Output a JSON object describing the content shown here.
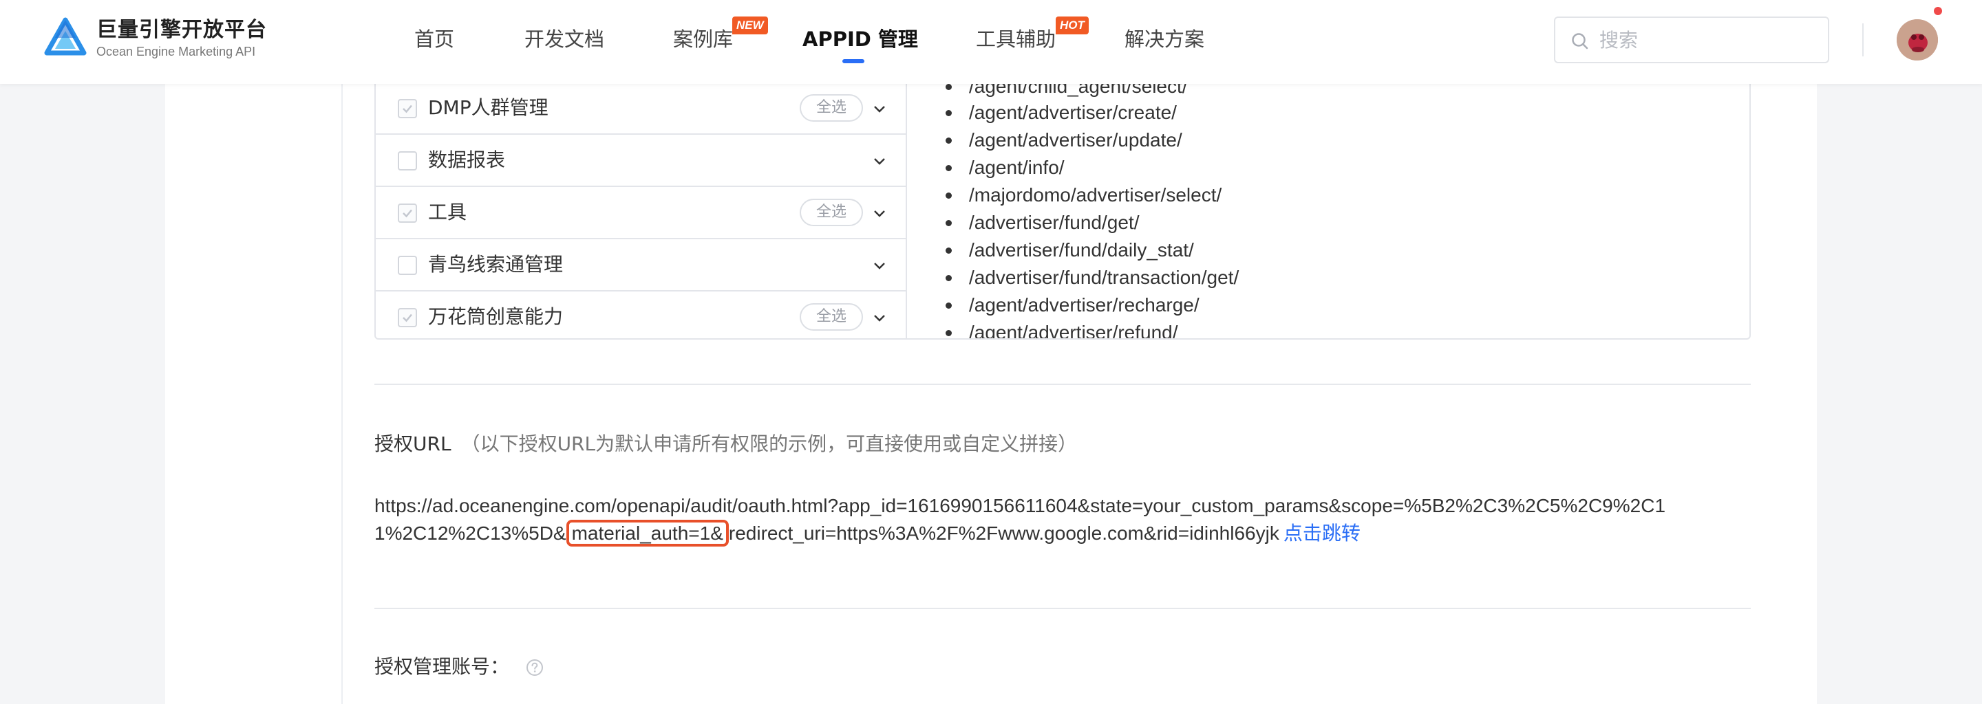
{
  "header": {
    "logo_title": "巨量引擎开放平台",
    "logo_subtitle": "Ocean Engine Marketing API",
    "nav": [
      {
        "label": "首页"
      },
      {
        "label": "开发文档"
      },
      {
        "label": "案例库",
        "badge": "NEW"
      },
      {
        "label": "APPID 管理",
        "active": true
      },
      {
        "label": "工具辅助",
        "badge": "HOT"
      },
      {
        "label": "解决方案"
      }
    ],
    "search_placeholder": "搜索",
    "accent_color": "#2a6ef6",
    "badge_color": "#f15a24"
  },
  "permissions": {
    "rows": [
      {
        "label": "DMP人群管理",
        "checked": true,
        "select_all": "全选"
      },
      {
        "label": "数据报表",
        "checked": false
      },
      {
        "label": "工具",
        "checked": true,
        "select_all": "全选"
      },
      {
        "label": "青鸟线索通管理",
        "checked": false
      },
      {
        "label": "万花筒创意能力",
        "checked": true,
        "select_all": "全选"
      }
    ],
    "apis": [
      "/agent/child_agent/select/",
      "/agent/advertiser/create/",
      "/agent/advertiser/update/",
      "/agent/info/",
      "/majordomo/advertiser/select/",
      "/advertiser/fund/get/",
      "/advertiser/fund/daily_stat/",
      "/advertiser/fund/transaction/get/",
      "/agent/advertiser/recharge/",
      "/agent/advertiser/refund/"
    ]
  },
  "auth_url": {
    "title": "授权URL",
    "note": "（以下授权URL为默认申请所有权限的示例，可直接使用或自定义拼接）",
    "line1": "https://ad.oceanengine.com/openapi/audit/oauth.html?app_id=1616990156611604&state=your_custom_params&scope=%5B2%2C3%2C5%2C9%2C1",
    "line2_before": "1%2C12%2C13%5D&",
    "line2_highlight": "material_auth=1&",
    "line2_after": "redirect_uri=https%3A%2F%2Fwww.google.com&rid=idinhl66yjk",
    "link_label": "点击跳转",
    "highlight_color": "#e8502a"
  },
  "auth_account": {
    "label": "授权管理账号："
  }
}
